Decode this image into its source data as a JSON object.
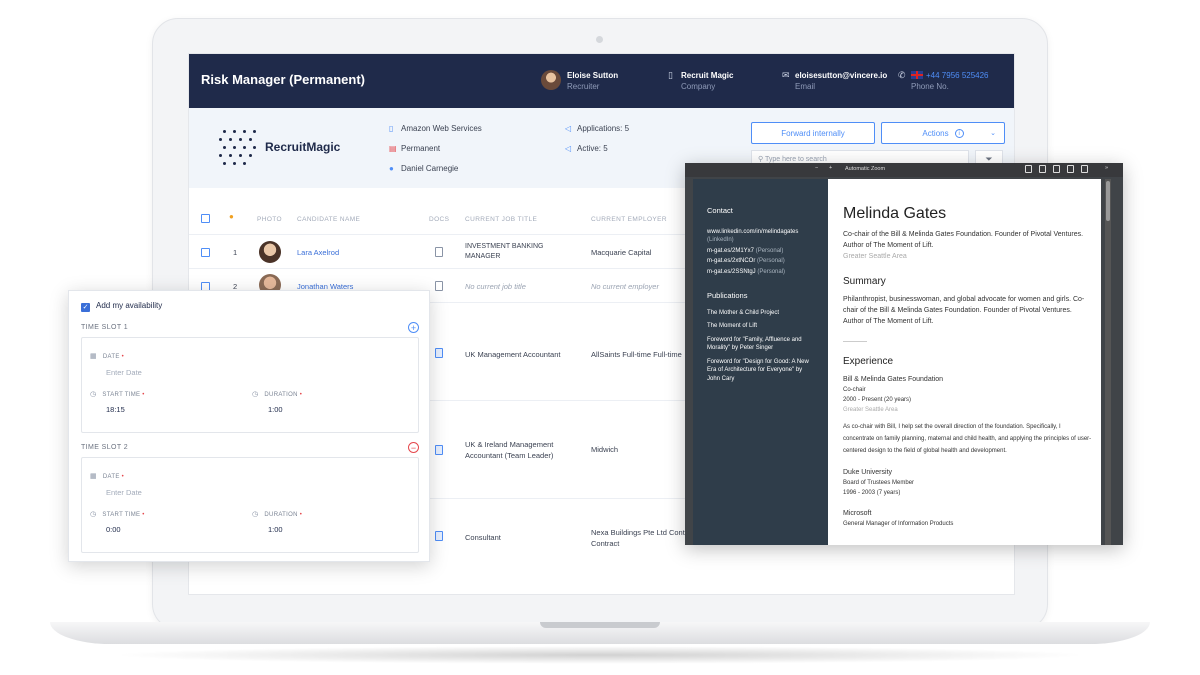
{
  "header": {
    "title": "Risk Manager (Permanent)",
    "contact_name": "Eloise Sutton",
    "contact_role": "Recruiter",
    "company_name": "Recruit Magic",
    "company_label": "Company",
    "email": "eloisesutton@vincere.io",
    "email_label": "Email",
    "phone": "+44 7956 525426",
    "phone_label": "Phone No."
  },
  "info": {
    "logo_text": "RecruitMagic",
    "client": "Amazon Web Services",
    "job_type": "Permanent",
    "owner": "Daniel Carnegie",
    "applications": "Applications: 5",
    "active": "Active: 5",
    "forward_button": "Forward internally",
    "actions_button": "Actions",
    "search_placeholder": "Type here to search"
  },
  "table": {
    "headers": [
      "PHOTO",
      "CANDIDATE NAME",
      "DOCS",
      "CURRENT JOB TITLE",
      "CURRENT EMPLOYER"
    ],
    "rows": [
      {
        "num": "1",
        "name": "Lara Axelrod",
        "title": "INVESTMENT BANKING MANAGER",
        "employer": "Macquarie Capital"
      },
      {
        "num": "2",
        "name": "Jonathan Waters",
        "title": "No current job title",
        "employer": "No current employer"
      },
      {
        "title": "UK Management Accountant",
        "employer": "AllSaints Full-time Full-time"
      },
      {
        "title": "UK & Ireland Management Accountant (Team Leader)",
        "employer": "Midwich"
      },
      {
        "title": "Consultant",
        "employer": "Nexa Buildings Pte Ltd Contract Contract"
      }
    ]
  },
  "availability": {
    "toggle_label": "Add my availability",
    "slots": [
      {
        "label": "TIME SLOT 1",
        "date_label": "DATE",
        "date_placeholder": "Enter Date",
        "start_label": "START TIME",
        "start_value": "18:15",
        "duration_label": "DURATION",
        "duration_value": "1:00"
      },
      {
        "label": "TIME SLOT 2",
        "date_label": "DATE",
        "date_placeholder": "Enter Date",
        "start_label": "START TIME",
        "start_value": "0:00",
        "duration_label": "DURATION",
        "duration_value": "1:00"
      }
    ]
  },
  "pdf": {
    "zoom": "Automatic Zoom",
    "contact_heading": "Contact",
    "links": [
      {
        "text": "www.linkedin.com/in/melindagates",
        "note": "(LinkedIn)"
      },
      {
        "text": "m-gat.es/2M1Yx7",
        "note": "(Personal)"
      },
      {
        "text": "m-gat.es/2xtNCOr",
        "note": "(Personal)"
      },
      {
        "text": "m-gat.es/2SSNtgJ",
        "note": "(Personal)"
      }
    ],
    "publications_heading": "Publications",
    "publications": [
      "The Mother & Child Project",
      "The Moment of Lift",
      "Foreword for \"Family, Affluence and Morality\" by Peter Singer",
      "Foreword for \"Design for Good: A New Era of Architecture for Everyone\" by John Cary"
    ],
    "name": "Melinda Gates",
    "tagline": "Co-chair of the Bill & Melinda Gates Foundation. Founder of Pivotal Ventures. Author of The Moment of Lift.",
    "location": "Greater Seattle Area",
    "summary_heading": "Summary",
    "summary": "Philanthropist, businesswoman, and global advocate for women and girls. Co-chair of the Bill & Melinda Gates Foundation. Founder of Pivotal Ventures. Author of The Moment of Lift.",
    "experience_heading": "Experience",
    "exp1_org": "Bill & Melinda Gates Foundation",
    "exp1_role": "Co-chair",
    "exp1_dates": "2000 - Present (20 years)",
    "exp1_loc": "Greater Seattle Area",
    "exp1_desc": "As co-chair with Bill, I help set the overall direction of the foundation. Specifically, I concentrate on family planning, maternal and child health, and applying the principles of user-centered design to the field of global health and development.",
    "exp2_org": "Duke University",
    "exp2_role": "Board of Trustees Member",
    "exp2_dates": "1996 - 2003 (7 years)",
    "exp3_org": "Microsoft",
    "exp3_role": "General Manager of Information Products"
  }
}
